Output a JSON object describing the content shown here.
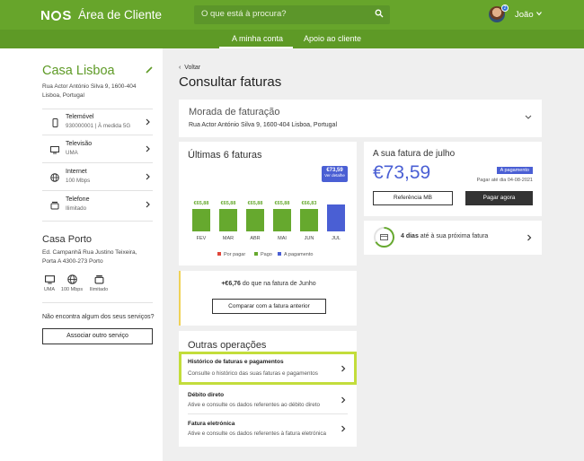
{
  "header": {
    "logo": "NOS",
    "app_title": "Área de Cliente",
    "search_placeholder": "O que está à procura?",
    "user_name": "João",
    "notification_count": "2"
  },
  "nav": {
    "tabs": [
      {
        "label": "A minha conta",
        "active": true
      },
      {
        "label": "Apoio ao cliente",
        "active": false
      }
    ]
  },
  "sidebar": {
    "home1": {
      "title": "Casa Lisboa",
      "address": "Rua Actor António Silva 9, 1600-404 Lisboa, Portugal",
      "services": [
        {
          "name": "Telemóvel",
          "detail": "930000001 | À medida 5G",
          "icon": "phone-icon"
        },
        {
          "name": "Televisão",
          "detail": "UMA",
          "icon": "tv-icon"
        },
        {
          "name": "Internet",
          "detail": "100 Mbps",
          "icon": "globe-icon"
        },
        {
          "name": "Telefone",
          "detail": "Ilimitado",
          "icon": "landline-icon"
        }
      ]
    },
    "home2": {
      "title": "Casa Porto",
      "address": "Ed. Campanhã Rua Justino Teixeira, Porta A 4300-273 Porto",
      "services": [
        {
          "label": "UMA",
          "icon": "tv-icon"
        },
        {
          "label": "100 Mbps",
          "icon": "globe-icon"
        },
        {
          "label": "Ilimitado",
          "icon": "landline-icon"
        }
      ]
    },
    "question": "Não encontra algum dos seus serviços?",
    "associate_button": "Associar outro serviço"
  },
  "main": {
    "back": "Voltar",
    "title": "Consultar faturas",
    "morada": {
      "title": "Morada de faturação",
      "address": "Rua Actor António Silva 9, 1600-404 Lisboa, Portugal"
    },
    "ultimas": {
      "title": "Últimas 6 faturas",
      "tooltip_value": "€73,59",
      "tooltip_sub": "Ver detalhe",
      "legend": [
        "Por pagar",
        "Pago",
        "A pagamento"
      ],
      "colors": {
        "por_pagar": "#e0463a",
        "pago": "#66a92e",
        "a_pagamento": "#4a5fd4"
      }
    },
    "julho": {
      "title": "A sua fatura de julho",
      "amount": "€73,59",
      "status_badge": "A pagamento",
      "due": "Pagar até dia 04-08-2021",
      "btn_ref": "Referência MB",
      "btn_pay": "Pagar agora"
    },
    "proxima": {
      "days": "4 dias",
      "rest": " até à sua próxima fatura"
    },
    "compare": {
      "amount": "+€6,76",
      "rest": " do que na fatura de Junho",
      "button": "Comparar com a fatura anterior"
    },
    "outras": {
      "title": "Outras operações",
      "ops": [
        {
          "name": "Histórico de faturas e pagamentos",
          "desc": "Consulte o histórico das suas faturas e pagamentos"
        },
        {
          "name": "Débito direto",
          "desc": "Ative e consulte os dados referentes ao débito direto"
        },
        {
          "name": "Fatura eletrónica",
          "desc": "Ative e consulte os dados referentes à fatura eletrónica"
        }
      ]
    }
  },
  "chart_data": {
    "type": "bar",
    "categories": [
      "FEV",
      "MAR",
      "ABR",
      "MAI",
      "JUN",
      "JUL"
    ],
    "values": [
      65.88,
      65.88,
      65.88,
      65.88,
      66.83,
      73.59
    ],
    "value_labels": [
      "€65,88",
      "€65,88",
      "€65,88",
      "€65,88",
      "€66,83",
      "€73,59"
    ],
    "status": [
      "Pago",
      "Pago",
      "Pago",
      "Pago",
      "Pago",
      "A pagamento"
    ],
    "title": "Últimas 6 faturas"
  }
}
